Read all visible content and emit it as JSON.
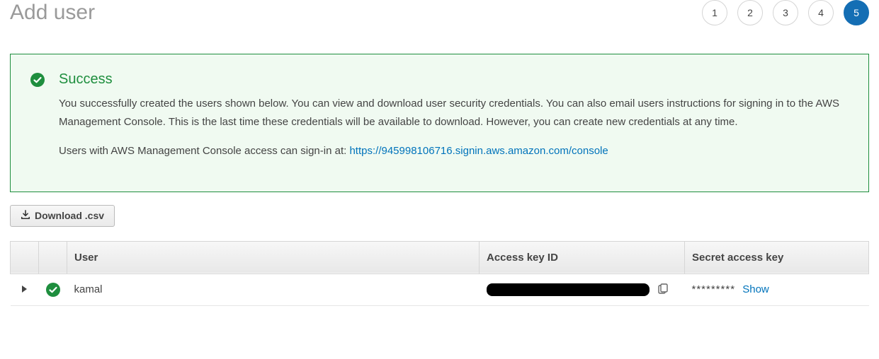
{
  "header": {
    "title": "Add user",
    "steps": [
      "1",
      "2",
      "3",
      "4",
      "5"
    ],
    "active_step_index": 4
  },
  "success": {
    "title": "Success",
    "message": "You successfully created the users shown below. You can view and download user security credentials. You can also email users instructions for signing in to the AWS Management Console. This is the last time these credentials will be available to download. However, you can create new credentials at any time.",
    "signin_prefix": "Users with AWS Management Console access can sign-in at: ",
    "signin_url": "https://945998106716.signin.aws.amazon.com/console"
  },
  "actions": {
    "download_label": "Download .csv"
  },
  "table": {
    "columns": {
      "user": "User",
      "access_key_id": "Access key ID",
      "secret_access_key": "Secret access key"
    },
    "rows": [
      {
        "username": "kamal",
        "secret_masked": "*********",
        "show_label": "Show"
      }
    ]
  }
}
